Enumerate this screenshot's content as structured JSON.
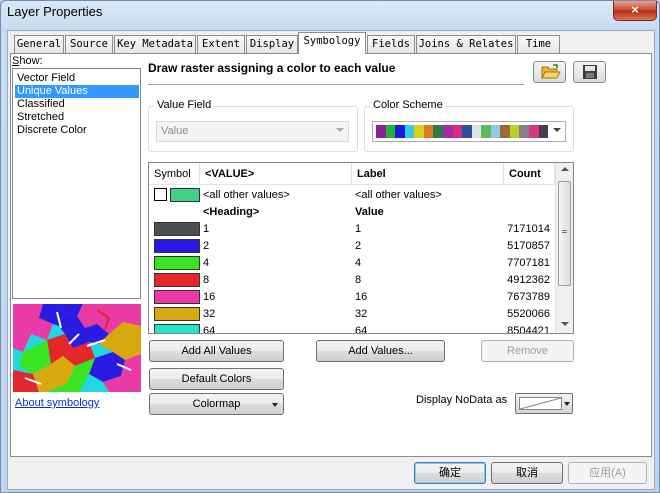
{
  "window": {
    "title": "Layer Properties",
    "close": "×"
  },
  "tabs": [
    {
      "label": "General"
    },
    {
      "label": "Source"
    },
    {
      "label": "Key Metadata"
    },
    {
      "label": "Extent"
    },
    {
      "label": "Display"
    },
    {
      "label": "Symbology",
      "active": true
    },
    {
      "label": "Fields"
    },
    {
      "label": "Joins & Relates"
    },
    {
      "label": "Time"
    }
  ],
  "show": {
    "label": "Show:",
    "items": [
      {
        "label": "Vector Field",
        "selected": false
      },
      {
        "label": "Unique Values",
        "selected": true
      },
      {
        "label": "Classified",
        "selected": false
      },
      {
        "label": "Stretched",
        "selected": false
      },
      {
        "label": "Discrete Color",
        "selected": false
      }
    ]
  },
  "about_link": "About symbology",
  "description": "Draw raster assigning a color to each value",
  "icons": {
    "open": "open-folder-icon",
    "save": "save-disk-icon"
  },
  "value_field": {
    "label": "Value Field",
    "value": "Value"
  },
  "color_scheme": {
    "label": "Color Scheme",
    "colors": [
      "#8d2093",
      "#28b232",
      "#1a1ae6",
      "#35c9e8",
      "#d6d21c",
      "#e07a1e",
      "#2d7f3f",
      "#a52aa8",
      "#d72a86",
      "#2b4e9e",
      "#e3e0e6",
      "#5fb95a",
      "#94c8e8",
      "#9a6a3a",
      "#b7d02c",
      "#8d7b8a",
      "#d63a7a",
      "#4a3a50"
    ]
  },
  "table": {
    "headers": {
      "symbol": "Symbol",
      "value": "<VALUE>",
      "label": "Label",
      "count": "Count"
    },
    "all_other": {
      "value": "<all other values>",
      "label": "<all other values>",
      "color": "#42d086"
    },
    "heading": {
      "value": "<Heading>",
      "label": "Value"
    },
    "rows": [
      {
        "value": "1",
        "label": "1",
        "count": "7171014",
        "color": "#4b514f"
      },
      {
        "value": "2",
        "label": "2",
        "count": "5170857",
        "color": "#2b1ae2"
      },
      {
        "value": "4",
        "label": "4",
        "count": "7707181",
        "color": "#39e523"
      },
      {
        "value": "8",
        "label": "8",
        "count": "4912362",
        "color": "#e3272a"
      },
      {
        "value": "16",
        "label": "16",
        "count": "7673789",
        "color": "#e93aa6"
      },
      {
        "value": "32",
        "label": "32",
        "count": "5520066",
        "color": "#d8a90e"
      },
      {
        "value": "64",
        "label": "64",
        "count": "8504421",
        "color": "#27e3c8"
      }
    ]
  },
  "buttons": {
    "add_all_values": "Add All Values",
    "add_values": "Add Values...",
    "remove": "Remove",
    "default_colors": "Default Colors",
    "colormap": "Colormap",
    "ok": "确定",
    "cancel": "取消",
    "apply": "应用(A)"
  },
  "nodata": {
    "label": "Display NoData as"
  }
}
